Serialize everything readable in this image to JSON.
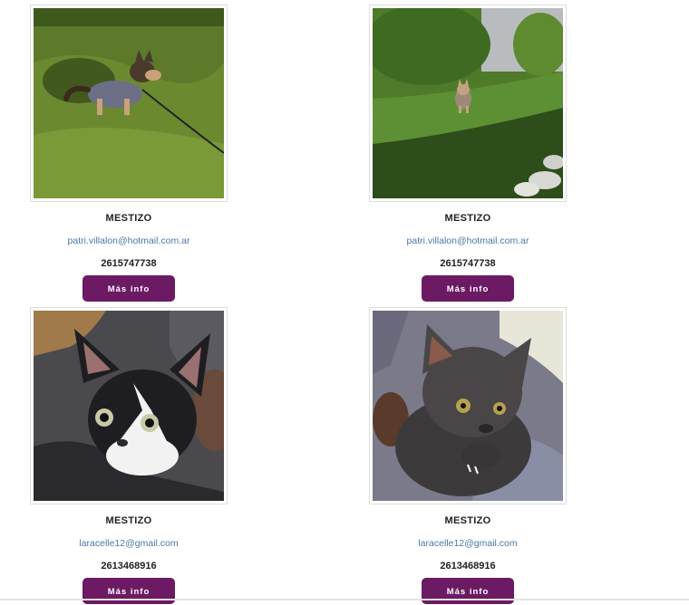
{
  "colors": {
    "button_bg": "#6b1a63",
    "email_link": "#4a78a8"
  },
  "pets": [
    {
      "photo": "dog-on-grass-with-leash",
      "breed": "MESTIZO",
      "email": "patri.villalon@hotmail.com.ar",
      "phone": "2615747738",
      "button_label": "Más info"
    },
    {
      "photo": "small-dog-in-garden",
      "breed": "MESTIZO",
      "email": "patri.villalon@hotmail.com.ar",
      "phone": "2615747738",
      "button_label": "Más info"
    },
    {
      "photo": "black-and-white-kitten",
      "breed": "MESTIZO",
      "email": "laracelle12@gmail.com",
      "phone": "2613468916",
      "button_label": "Más info"
    },
    {
      "photo": "grey-kitten-in-arms",
      "breed": "MESTIZO",
      "email": "laracelle12@gmail.com",
      "phone": "2613468916",
      "button_label": "Más info"
    }
  ]
}
